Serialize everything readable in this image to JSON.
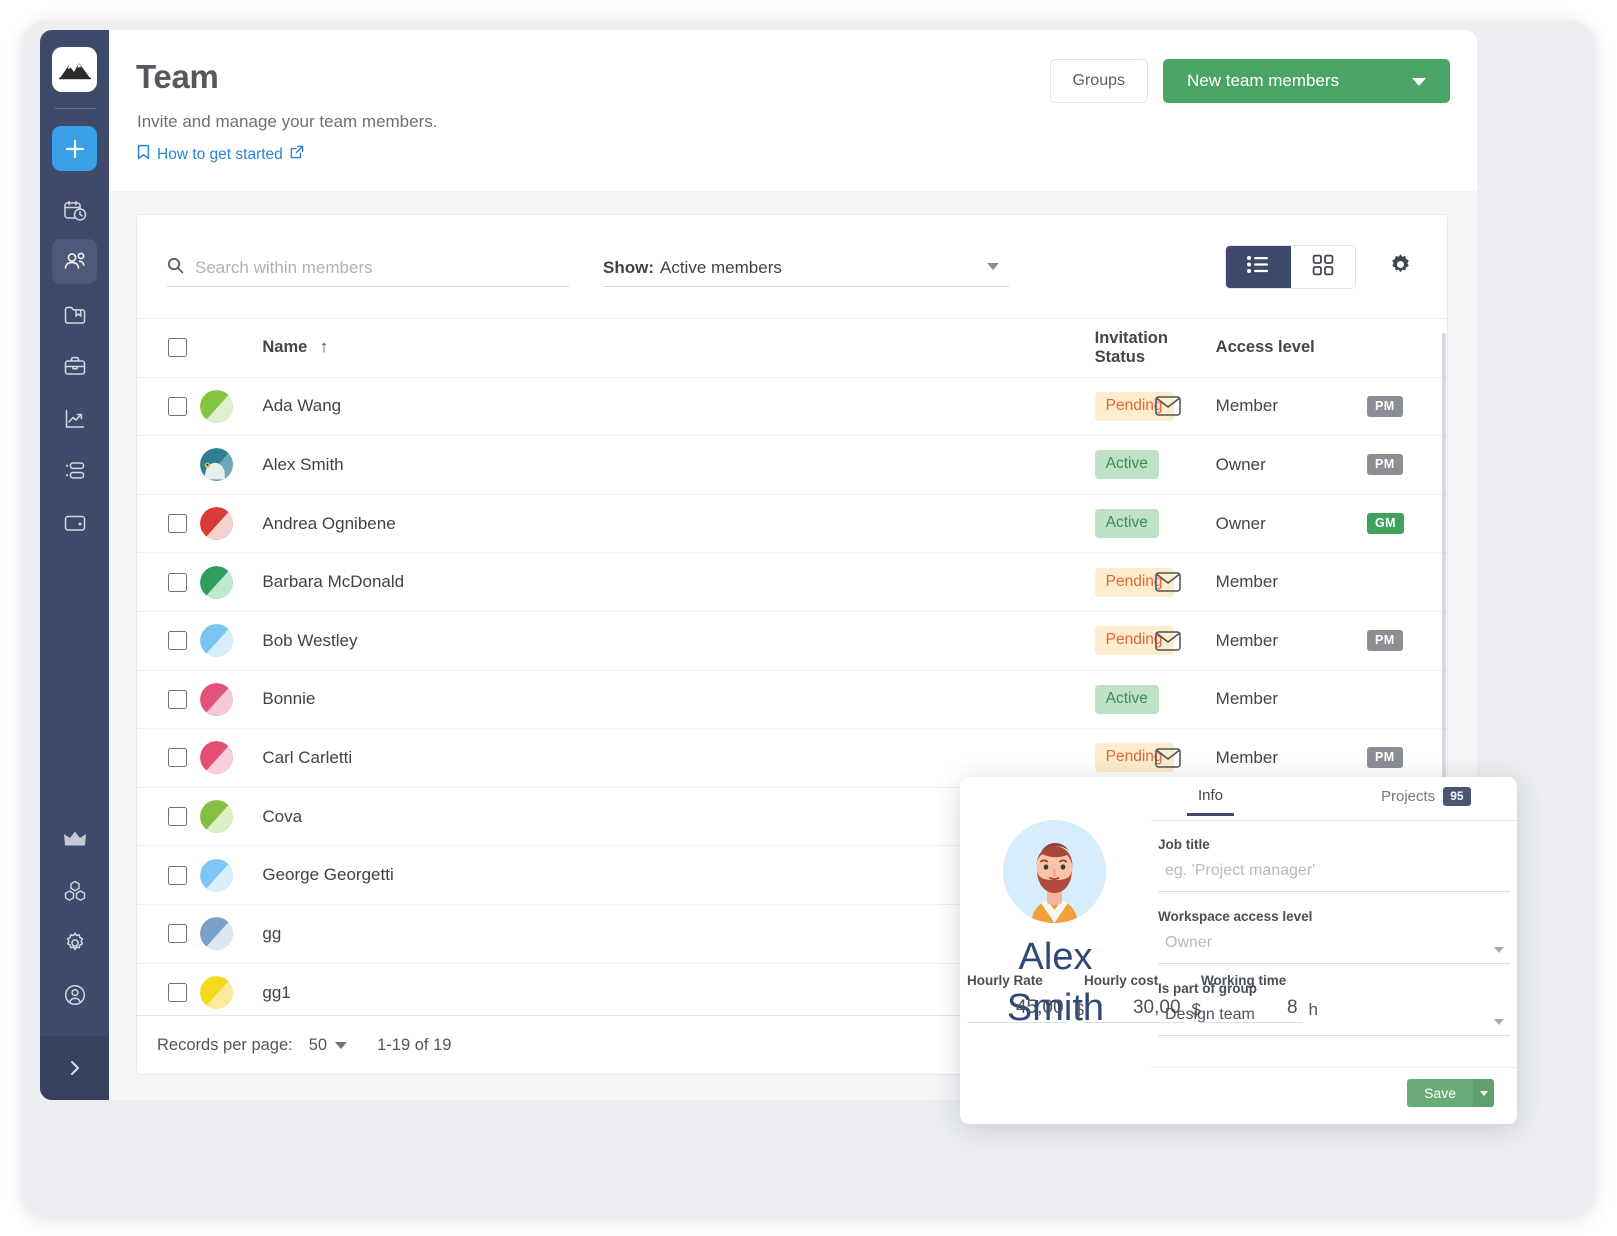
{
  "colors": {
    "sidebar_bg": "#3f4a6b",
    "accent_blue": "#3aa0e8",
    "accent_green": "#4aa564",
    "link_blue": "#2684d8",
    "pending_bg": "#fdeccd",
    "pending_fg": "#e2653a",
    "active_bg": "#bfe2c6",
    "active_fg": "#3d8c52",
    "pm_badge": "#8b8f95",
    "gm_badge": "#3fa35c"
  },
  "sidebar": {
    "logo_name": "mountain-logo",
    "items": [
      {
        "name": "add-button",
        "icon": "plus-icon",
        "state": "highlight"
      },
      {
        "name": "timesheet",
        "icon": "calendar-clock-icon",
        "state": "normal"
      },
      {
        "name": "team",
        "icon": "people-icon",
        "state": "active"
      },
      {
        "name": "files",
        "icon": "folder-bookmark-icon",
        "state": "normal"
      },
      {
        "name": "projects",
        "icon": "briefcase-icon",
        "state": "normal"
      },
      {
        "name": "reports",
        "icon": "chart-line-icon",
        "state": "normal"
      },
      {
        "name": "tasks",
        "icon": "list-bullets-icon",
        "state": "normal"
      },
      {
        "name": "expenses",
        "icon": "wallet-icon",
        "state": "normal"
      }
    ],
    "bottom_items": [
      {
        "name": "upgrade",
        "icon": "crown-icon"
      },
      {
        "name": "integrations",
        "icon": "cubes-icon"
      },
      {
        "name": "settings",
        "icon": "gear-icon"
      },
      {
        "name": "account",
        "icon": "user-circle-icon"
      },
      {
        "name": "history",
        "icon": "history-clock-icon"
      }
    ],
    "expand": {
      "name": "expand-sidebar",
      "icon": "chevron-right-icon"
    }
  },
  "header": {
    "title": "Team",
    "subtitle": "Invite and manage your team members.",
    "howto_label": "How to get started",
    "howto_icon": "bookmark-icon",
    "howto_external_icon": "external-link-icon",
    "groups_button": "Groups",
    "new_members_button": "New team members"
  },
  "toolbar": {
    "search_placeholder": "Search within members",
    "search_value": "",
    "search_icon": "search-icon",
    "show_label": "Show:",
    "show_value": "Active members",
    "view_list_icon": "list-view-icon",
    "view_grid_icon": "grid-view-icon",
    "settings_icon": "gear-icon"
  },
  "table": {
    "columns": {
      "name": "Name",
      "sort_indicator": "↑",
      "invitation_status": "Invitation Status",
      "access_level": "Access level"
    },
    "rows": [
      {
        "name": "Ada Wang",
        "avatar": "split-circle-green",
        "avatar_colors": [
          "#dff0cd",
          "#83c441"
        ],
        "checkbox": true,
        "status": "Pending",
        "mail_icon": true,
        "access": "Member",
        "role_badge": "PM"
      },
      {
        "name": "Alex Smith",
        "avatar": "photo-parrot",
        "avatar_colors": [
          "#6fa7b5",
          "#2e7f93"
        ],
        "checkbox": false,
        "status": "Active",
        "mail_icon": false,
        "access": "Owner",
        "role_badge": "PM"
      },
      {
        "name": "Andrea Ognibene",
        "avatar": "split-circle-red",
        "avatar_colors": [
          "#f6cfcf",
          "#d93a33"
        ],
        "checkbox": true,
        "status": "Active",
        "mail_icon": false,
        "access": "Owner",
        "role_badge": "GM"
      },
      {
        "name": "Barbara McDonald",
        "avatar": "split-circle-emerald",
        "avatar_colors": [
          "#bfe8cf",
          "#2f9e5f"
        ],
        "checkbox": true,
        "status": "Pending",
        "mail_icon": true,
        "access": "Member",
        "role_badge": ""
      },
      {
        "name": "Bob Westley",
        "avatar": "split-circle-lightblue",
        "avatar_colors": [
          "#d9eefc",
          "#79c5f2"
        ],
        "checkbox": true,
        "status": "Pending",
        "mail_icon": true,
        "access": "Member",
        "role_badge": "PM"
      },
      {
        "name": "Bonnie",
        "avatar": "split-circle-pink",
        "avatar_colors": [
          "#f5c9d4",
          "#e0547c"
        ],
        "checkbox": true,
        "status": "Active",
        "mail_icon": false,
        "access": "Member",
        "role_badge": ""
      },
      {
        "name": "Carl Carletti",
        "avatar": "split-circle-rose",
        "avatar_colors": [
          "#f7ced9",
          "#e34f74"
        ],
        "checkbox": true,
        "status": "Pending",
        "mail_icon": true,
        "access": "Member",
        "role_badge": "PM"
      },
      {
        "name": "Cova",
        "avatar": "split-circle-olive",
        "avatar_colors": [
          "#dcefc4",
          "#84bf3f"
        ],
        "checkbox": true,
        "status": "",
        "mail_icon": false,
        "access": "",
        "role_badge": ""
      },
      {
        "name": "George Georgetti",
        "avatar": "split-circle-sky",
        "avatar_colors": [
          "#daeffc",
          "#7cc7f3"
        ],
        "checkbox": true,
        "status": "",
        "mail_icon": false,
        "access": "",
        "role_badge": ""
      },
      {
        "name": "gg",
        "avatar": "split-circle-steelblue",
        "avatar_colors": [
          "#dde7f2",
          "#7a9fc9"
        ],
        "checkbox": true,
        "status": "",
        "mail_icon": false,
        "access": "",
        "role_badge": ""
      },
      {
        "name": "gg1",
        "avatar": "split-circle-yellow",
        "avatar_colors": [
          "#fbeb9b",
          "#f6d91e"
        ],
        "checkbox": true,
        "status": "",
        "mail_icon": false,
        "access": "",
        "role_badge": ""
      }
    ]
  },
  "footer": {
    "records_label": "Records per page:",
    "records_value": "50",
    "range": "1-19 of 19"
  },
  "detail_panel": {
    "avatar_name": "bearded-man-avatar",
    "person_first": "Alex",
    "person_last": "Smith",
    "tabs": {
      "info": "Info",
      "projects": "Projects",
      "projects_count": "95"
    },
    "fields": {
      "job_title_label": "Job title",
      "job_title_placeholder": "eg. 'Project manager'",
      "job_title_value": "",
      "access_label": "Workspace access level",
      "access_value": "Owner",
      "group_label": "Is part of group",
      "group_value": "Design team",
      "hourly_rate_label": "Hourly Rate",
      "hourly_rate_value": "45,00",
      "hourly_rate_unit": "$",
      "hourly_cost_label": "Hourly cost",
      "hourly_cost_value": "30,00",
      "hourly_cost_unit": "$",
      "working_time_label": "Working time",
      "working_time_value": "8",
      "working_time_unit": "h"
    },
    "save_button": "Save"
  }
}
